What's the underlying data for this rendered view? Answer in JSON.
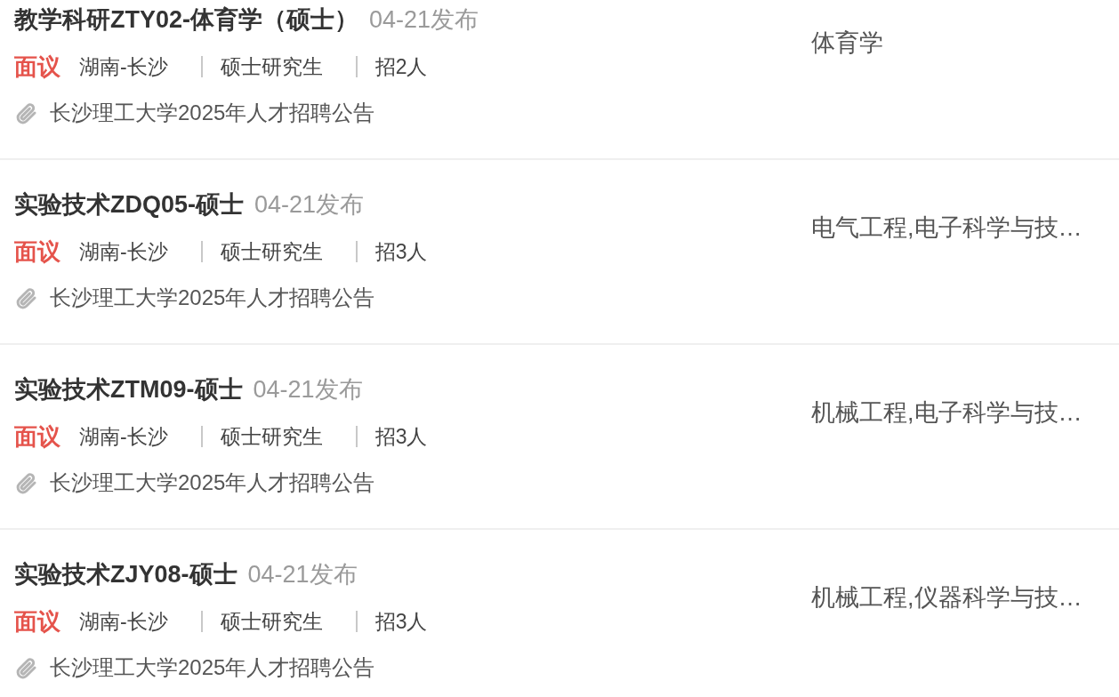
{
  "jobs": [
    {
      "title": "教学科研ZTY02-体育学（硕士）",
      "date": "04-21发布",
      "salary": "面议",
      "location": "湖南-长沙",
      "education": "硕士研究生",
      "headcount": "招2人",
      "announcement": "长沙理工大学2025年人才招聘公告",
      "majors": "体育学"
    },
    {
      "title": "实验技术ZDQ05-硕士",
      "date": "04-21发布",
      "salary": "面议",
      "location": "湖南-长沙",
      "education": "硕士研究生",
      "headcount": "招3人",
      "announcement": "长沙理工大学2025年人才招聘公告",
      "majors": "电气工程,电子科学与技…"
    },
    {
      "title": "实验技术ZTM09-硕士",
      "date": "04-21发布",
      "salary": "面议",
      "location": "湖南-长沙",
      "education": "硕士研究生",
      "headcount": "招3人",
      "announcement": "长沙理工大学2025年人才招聘公告",
      "majors": "机械工程,电子科学与技…"
    },
    {
      "title": "实验技术ZJY08-硕士",
      "date": "04-21发布",
      "salary": "面议",
      "location": "湖南-长沙",
      "education": "硕士研究生",
      "headcount": "招3人",
      "announcement": "长沙理工大学2025年人才招聘公告",
      "majors": "机械工程,仪器科学与技…"
    }
  ]
}
